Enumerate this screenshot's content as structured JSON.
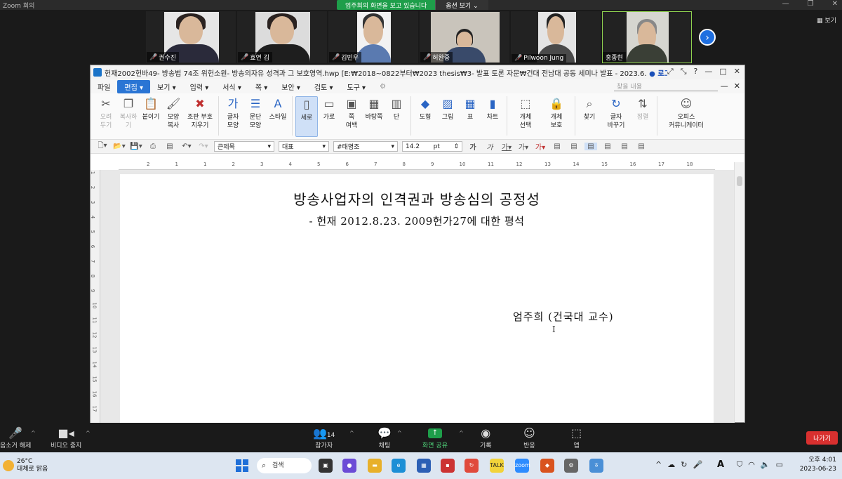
{
  "zoom": {
    "window_title": "Zoom 회의",
    "share_banner": "엄주희의 화면을 보고 있습니다",
    "view_options": "옵션 보기",
    "view_label": "보기",
    "participants": [
      {
        "name": "권수진",
        "muted": true
      },
      {
        "name": "효연 김",
        "muted": true
      },
      {
        "name": "김민우",
        "muted": true
      },
      {
        "name": "허완중",
        "muted": true
      },
      {
        "name": "Pilwoon Jung",
        "muted": true
      },
      {
        "name": "홍종현",
        "muted": false
      }
    ],
    "toolbar": {
      "mute": "음소거 해제",
      "video": "비디오 중지",
      "participants": "참가자",
      "participants_count": "14",
      "chat": "채팅",
      "share": "화면 공유",
      "record": "기록",
      "reactions": "반응",
      "apps": "앱",
      "leave": "나가기"
    }
  },
  "hwp": {
    "title": "헌재2002헌바49- 방송법 74조 위헌소원- 방송의자유 성격과 그 보호영역.hwp [E:₩2018~0822부터₩2023 thesis₩3- 발표 토론 자문₩건대 전남대 공동 세미나 발표 - 2023.6.23.₩]",
    "login": "로그인",
    "menu": [
      "파일",
      "편집",
      "보기",
      "입력",
      "서식",
      "쪽",
      "보안",
      "검토",
      "도구"
    ],
    "menu_active": "편집",
    "search_placeholder": "찾을 내용",
    "ribbon": [
      {
        "l1": "오려",
        "l2": "두기",
        "icon": "scissors-icon",
        "g": "✂",
        "dim": true
      },
      {
        "l1": "복사하기",
        "l2": "",
        "icon": "copy-icon",
        "g": "❐",
        "dim": true
      },
      {
        "l1": "붙이기",
        "l2": "",
        "icon": "paste-icon",
        "g": "📋"
      },
      {
        "l1": "모양",
        "l2": "복사",
        "icon": "format-painter-icon",
        "g": "🖌"
      },
      {
        "l1": "조판 부호",
        "l2": "지우기",
        "icon": "clear-marks-icon",
        "g": "✖"
      },
      {
        "l1": "글자",
        "l2": "모양",
        "icon": "char-shape-icon",
        "g": "가"
      },
      {
        "l1": "문단",
        "l2": "모양",
        "icon": "paragraph-shape-icon",
        "g": "☰"
      },
      {
        "l1": "스타일",
        "l2": "",
        "icon": "style-icon",
        "g": "A"
      },
      {
        "l1": "세로",
        "l2": "",
        "icon": "portrait-icon",
        "g": "▯",
        "sel": true
      },
      {
        "l1": "가로",
        "l2": "",
        "icon": "landscape-icon",
        "g": "▭"
      },
      {
        "l1": "쪽",
        "l2": "여백",
        "icon": "margin-icon",
        "g": "▣"
      },
      {
        "l1": "바탕쪽",
        "l2": "",
        "icon": "master-page-icon",
        "g": "▦"
      },
      {
        "l1": "단",
        "l2": "",
        "icon": "columns-icon",
        "g": "▥"
      },
      {
        "l1": "도형",
        "l2": "",
        "icon": "shape-icon",
        "g": "◆"
      },
      {
        "l1": "그림",
        "l2": "",
        "icon": "picture-icon",
        "g": "▨"
      },
      {
        "l1": "표",
        "l2": "",
        "icon": "table-icon",
        "g": "▦"
      },
      {
        "l1": "차트",
        "l2": "",
        "icon": "chart-icon",
        "g": "▮"
      },
      {
        "l1": "개체",
        "l2": "선택",
        "icon": "select-object-icon",
        "g": "⬚"
      },
      {
        "l1": "개체",
        "l2": "보호",
        "icon": "protect-object-icon",
        "g": "🔒"
      },
      {
        "l1": "찾기",
        "l2": "",
        "icon": "find-icon",
        "g": "⌕"
      },
      {
        "l1": "글자",
        "l2": "바꾸기",
        "icon": "replace-icon",
        "g": "↻"
      },
      {
        "l1": "정렬",
        "l2": "",
        "icon": "sort-icon",
        "g": "⇅",
        "dim": true
      },
      {
        "l1": "오피스",
        "l2": "커뮤니케이터",
        "icon": "communicator-icon",
        "g": "☺"
      }
    ],
    "format": {
      "style": "큰제목",
      "lang": "대표",
      "font": "#태명조",
      "size": "14.2",
      "unit": "pt"
    },
    "ruler_ticks": [
      "2",
      "1",
      "1",
      "2",
      "3",
      "4",
      "5",
      "6",
      "7",
      "8",
      "9",
      "10",
      "11",
      "12",
      "13",
      "14",
      "15",
      "16",
      "17",
      "18"
    ],
    "vruler_ticks": [
      "1",
      "2",
      "3",
      "4",
      "5",
      "6",
      "7",
      "8",
      "9",
      "10",
      "11",
      "12",
      "13",
      "14",
      "15",
      "16",
      "17"
    ],
    "document": {
      "title": "방송사업자의 인격권과 방송심의 공정성",
      "subtitle": "- 헌재 2012.8.23. 2009헌가27에 대한 평석",
      "author": "엄주희 (건국대 교수)"
    }
  },
  "taskbar": {
    "temp": "26°C",
    "weather": "대체로 맑음",
    "search": "검색",
    "time": "오후 4:01",
    "date": "2023-06-23",
    "lang": "A"
  }
}
